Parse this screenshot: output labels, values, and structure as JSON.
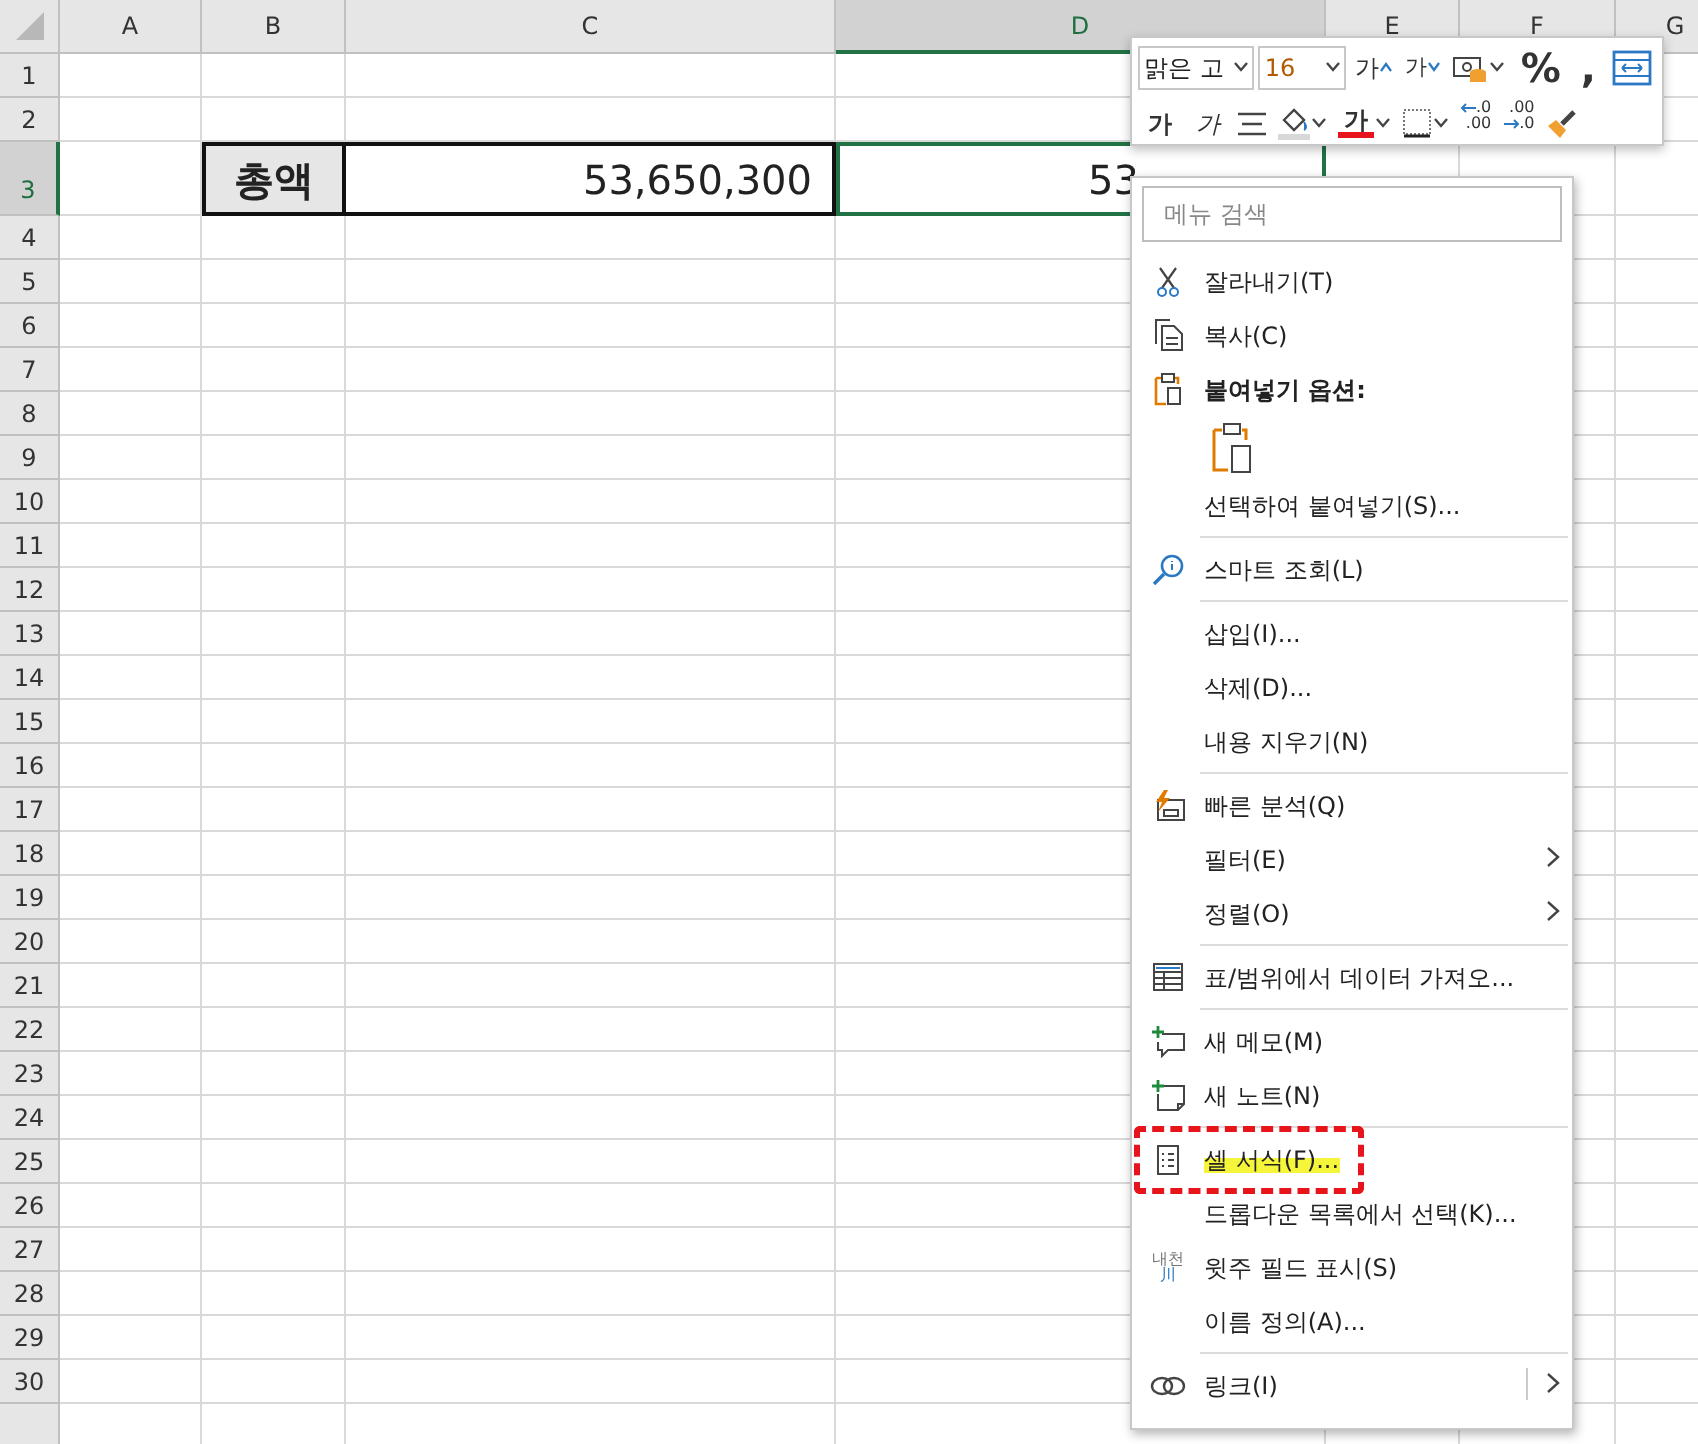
{
  "sheet": {
    "columns": [
      {
        "label": "A",
        "selected": false
      },
      {
        "label": "B",
        "selected": false
      },
      {
        "label": "C",
        "selected": false
      },
      {
        "label": "D",
        "selected": true
      },
      {
        "label": "E",
        "selected": false
      },
      {
        "label": "F",
        "selected": false
      },
      {
        "label": "G",
        "selected": false
      }
    ],
    "rows": [
      {
        "label": "1",
        "selected": false
      },
      {
        "label": "2",
        "selected": false
      },
      {
        "label": "3",
        "selected": true,
        "cells": [
          {
            "kind": "header",
            "text": "총액",
            "selected": false
          },
          {
            "kind": "value",
            "text": "53,650,300",
            "selected": false
          },
          {
            "kind": "value",
            "text": "53",
            "selected": true
          }
        ]
      },
      {
        "label": "4",
        "selected": false
      },
      {
        "label": "5",
        "selected": false
      },
      {
        "label": "6",
        "selected": false
      },
      {
        "label": "7",
        "selected": false
      },
      {
        "label": "8",
        "selected": false
      },
      {
        "label": "9",
        "selected": false
      },
      {
        "label": "10",
        "selected": false
      },
      {
        "label": "11",
        "selected": false
      },
      {
        "label": "12",
        "selected": false
      },
      {
        "label": "13",
        "selected": false
      },
      {
        "label": "14",
        "selected": false
      },
      {
        "label": "15",
        "selected": false
      },
      {
        "label": "16",
        "selected": false
      },
      {
        "label": "17",
        "selected": false
      },
      {
        "label": "18",
        "selected": false
      },
      {
        "label": "19",
        "selected": false
      },
      {
        "label": "20",
        "selected": false
      },
      {
        "label": "21",
        "selected": false
      },
      {
        "label": "22",
        "selected": false
      },
      {
        "label": "23",
        "selected": false
      },
      {
        "label": "24",
        "selected": false
      },
      {
        "label": "25",
        "selected": false
      },
      {
        "label": "26",
        "selected": false
      },
      {
        "label": "27",
        "selected": false
      },
      {
        "label": "28",
        "selected": false
      },
      {
        "label": "29",
        "selected": false
      },
      {
        "label": "30",
        "selected": false
      }
    ]
  },
  "mini_toolbar": {
    "row1": [
      {
        "kind": "font",
        "value": "맑은 고"
      },
      {
        "kind": "size",
        "value": "16"
      },
      {
        "kind": "grow",
        "text": "가"
      },
      {
        "kind": "shrink",
        "text": "가"
      },
      {
        "kind": "accounting"
      },
      {
        "kind": "glyph",
        "text": "%"
      },
      {
        "kind": "glyph",
        "text": ","
      },
      {
        "kind": "wrap"
      }
    ],
    "row2": [
      {
        "kind": "bold",
        "text": "가"
      },
      {
        "kind": "italic",
        "text": "가"
      },
      {
        "kind": "align"
      },
      {
        "kind": "fill"
      },
      {
        "kind": "font_color",
        "text": "가"
      },
      {
        "kind": "borders"
      },
      {
        "kind": "decimal_less",
        "top": ".0",
        "bottom": ".00"
      },
      {
        "kind": "decimal_more",
        "top": ".00",
        "bottom": ".0"
      },
      {
        "kind": "painter"
      }
    ]
  },
  "menu": {
    "search": {
      "placeholder": "메뉴 검색"
    },
    "items": [
      {
        "kind": "item",
        "label": "잘라내기(T)",
        "submenu": false,
        "highlighted": false,
        "annotated": false
      },
      {
        "kind": "item",
        "label": "복사(C)",
        "submenu": false,
        "highlighted": false,
        "annotated": false
      },
      {
        "kind": "heading",
        "label": "붙여넣기 옵션:"
      },
      {
        "kind": "paste_option"
      },
      {
        "kind": "item",
        "label": "선택하여 붙여넣기(S)...",
        "submenu": false,
        "highlighted": false,
        "annotated": false
      },
      {
        "kind": "separator"
      },
      {
        "kind": "item",
        "label": "스마트 조회(L)",
        "submenu": false,
        "highlighted": false,
        "annotated": false
      },
      {
        "kind": "separator"
      },
      {
        "kind": "item",
        "label": "삽입(I)...",
        "submenu": false,
        "highlighted": false,
        "annotated": false
      },
      {
        "kind": "item",
        "label": "삭제(D)...",
        "submenu": false,
        "highlighted": false,
        "annotated": false
      },
      {
        "kind": "item",
        "label": "내용 지우기(N)",
        "submenu": false,
        "highlighted": false,
        "annotated": false
      },
      {
        "kind": "separator"
      },
      {
        "kind": "item",
        "label": "빠른 분석(Q)",
        "submenu": false,
        "highlighted": false,
        "annotated": false
      },
      {
        "kind": "item",
        "label": "필터(E)",
        "submenu": true,
        "highlighted": false,
        "annotated": false
      },
      {
        "kind": "item",
        "label": "정렬(O)",
        "submenu": true,
        "highlighted": false,
        "annotated": false
      },
      {
        "kind": "separator"
      },
      {
        "kind": "item",
        "label": "표/범위에서 데이터 가져오...",
        "submenu": false,
        "highlighted": false,
        "annotated": false
      },
      {
        "kind": "separator"
      },
      {
        "kind": "item",
        "label": "새 메모(M)",
        "submenu": false,
        "highlighted": false,
        "annotated": false
      },
      {
        "kind": "item",
        "label": "새 노트(N)",
        "submenu": false,
        "highlighted": false,
        "annotated": false
      },
      {
        "kind": "separator"
      },
      {
        "kind": "item",
        "label": "셀 서식(F)...",
        "submenu": false,
        "highlighted": true,
        "annotated": true
      },
      {
        "kind": "item",
        "label": "드롭다운 목록에서 선택(K)...",
        "submenu": false,
        "highlighted": false,
        "annotated": false
      },
      {
        "kind": "item",
        "label": "윗주 필드 표시(S)",
        "submenu": false,
        "highlighted": false,
        "annotated": false,
        "icon_text": "내천",
        "icon_subtext": "川"
      },
      {
        "kind": "item",
        "label": "이름 정의(A)...",
        "submenu": false,
        "highlighted": false,
        "annotated": false
      },
      {
        "kind": "separator"
      },
      {
        "kind": "split_item",
        "label": "링크(I)",
        "submenu": true,
        "highlighted": false,
        "annotated": false
      }
    ]
  }
}
